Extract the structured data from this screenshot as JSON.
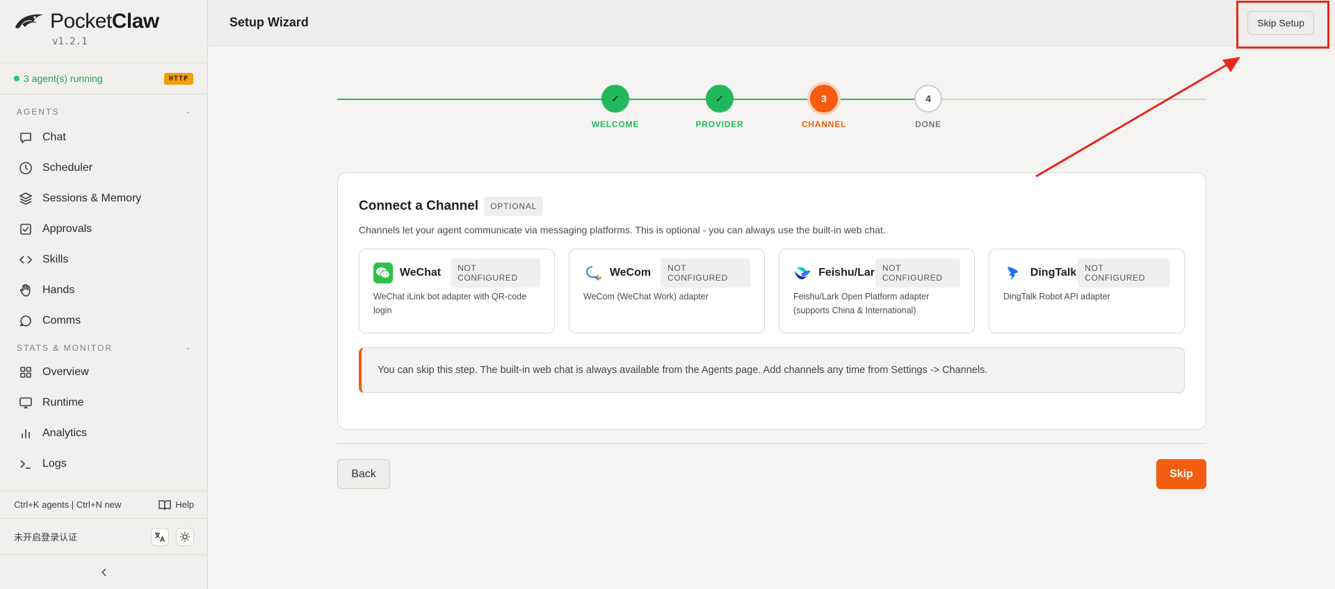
{
  "app": {
    "name_regular": "Pocket",
    "name_bold": "Claw",
    "version": "v1.2.1"
  },
  "status": {
    "agents_running": "3 agent(s) running",
    "protocol_badge": "HTTP"
  },
  "sidebar": {
    "sections": [
      {
        "title": "AGENTS",
        "toggle": "-",
        "items": [
          {
            "label": "Chat",
            "icon": "chat-icon"
          },
          {
            "label": "Scheduler",
            "icon": "clock-icon"
          },
          {
            "label": "Sessions & Memory",
            "icon": "layers-icon"
          },
          {
            "label": "Approvals",
            "icon": "checkbox-icon"
          },
          {
            "label": "Skills",
            "icon": "code-icon"
          },
          {
            "label": "Hands",
            "icon": "hand-icon"
          },
          {
            "label": "Comms",
            "icon": "comms-icon"
          }
        ]
      },
      {
        "title": "STATS & MONITOR",
        "toggle": "-",
        "items": [
          {
            "label": "Overview",
            "icon": "grid-icon"
          },
          {
            "label": "Runtime",
            "icon": "monitor-icon"
          },
          {
            "label": "Analytics",
            "icon": "bar-chart-icon"
          },
          {
            "label": "Logs",
            "icon": "terminal-icon"
          }
        ]
      }
    ],
    "shortcuts": "Ctrl+K agents | Ctrl+N new",
    "help_label": "Help",
    "auth_status": "未开启登录认证",
    "collapse_icon": "chevron-left-icon"
  },
  "header": {
    "title": "Setup Wizard",
    "skip_setup_label": "Skip Setup"
  },
  "stepper": {
    "steps": [
      {
        "label": "WELCOME",
        "marker": "✓",
        "state": "done"
      },
      {
        "label": "PROVIDER",
        "marker": "✓",
        "state": "done"
      },
      {
        "label": "CHANNEL",
        "marker": "3",
        "state": "active"
      },
      {
        "label": "DONE",
        "marker": "4",
        "state": "pending"
      }
    ],
    "colors": {
      "done": "#22b95a",
      "active": "#f45d0f",
      "pending": "#cfcdc9"
    }
  },
  "card": {
    "title": "Connect a Channel",
    "badge": "OPTIONAL",
    "description": "Channels let your agent communicate via messaging platforms. This is optional - you can always use the built-in web chat.",
    "channels": [
      {
        "name": "WeChat",
        "status": "NOT CONFIGURED",
        "description": "WeChat iLink bot adapter with QR-code login",
        "icon": "wechat-icon"
      },
      {
        "name": "WeCom",
        "status": "NOT CONFIGURED",
        "description": "WeCom (WeChat Work) adapter",
        "icon": "wecom-icon"
      },
      {
        "name": "Feishu/Lark",
        "status": "NOT CONFIGURED",
        "description": "Feishu/Lark Open Platform adapter (supports China & International)",
        "icon": "feishu-icon"
      },
      {
        "name": "DingTalk",
        "status": "NOT CONFIGURED",
        "description": "DingTalk Robot API adapter",
        "icon": "dingtalk-icon"
      }
    ],
    "note": "You can skip this step. The built-in web chat is always available from the Agents page. Add channels any time from Settings -> Channels."
  },
  "actions": {
    "back_label": "Back",
    "skip_label": "Skip"
  },
  "colors": {
    "accent": "#f45d0f",
    "success": "#22b95a",
    "annotation": "#e8261e"
  }
}
